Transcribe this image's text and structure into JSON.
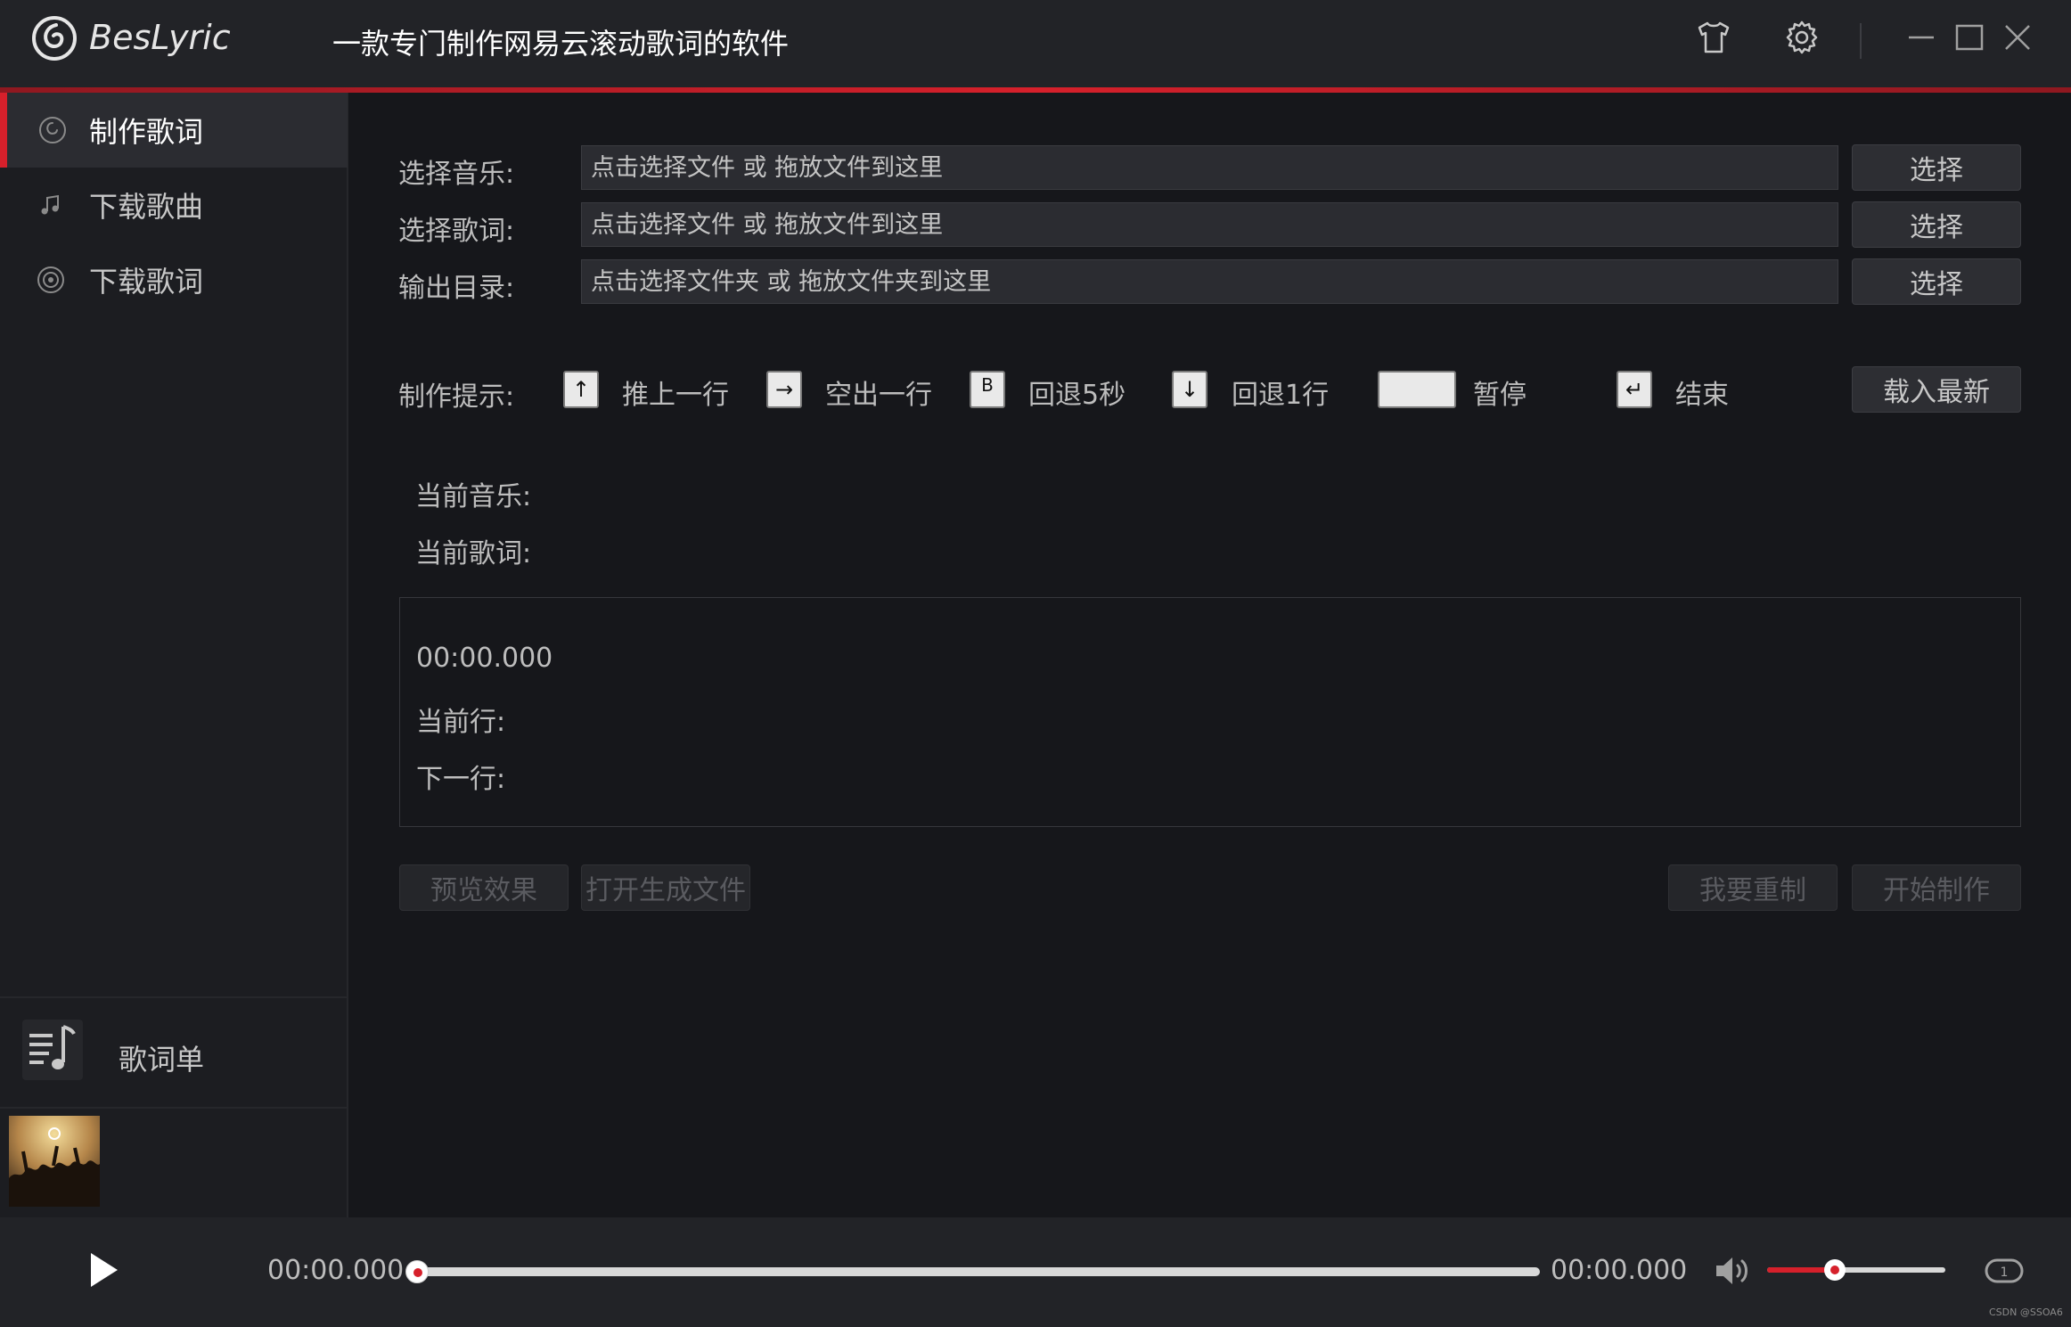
{
  "app": {
    "name": "BesLyric",
    "subtitle": "一款专门制作网易云滚动歌词的软件"
  },
  "sidebar": {
    "items": [
      {
        "label": "制作歌词",
        "icon": "make-lyric-icon"
      },
      {
        "label": "下载歌曲",
        "icon": "music-note-icon"
      },
      {
        "label": "下载歌词",
        "icon": "download-lyric-icon"
      }
    ],
    "playlist_label": "歌词单"
  },
  "form": {
    "music_label": "选择音乐:",
    "lyric_label": "选择歌词:",
    "output_label": "输出目录:",
    "music_placeholder": "点击选择文件 或 拖放文件到这里",
    "lyric_placeholder": "点击选择文件 或 拖放文件到这里",
    "output_placeholder": "点击选择文件夹 或 拖放文件夹到这里",
    "choose_label": "选择"
  },
  "hints": {
    "label": "制作提示:",
    "up_key": "↑",
    "up_text": "推上一行",
    "right_key": "→",
    "right_text": "空出一行",
    "b_key": "B",
    "b_text": "回退5秒",
    "down_key": "↓",
    "down_text": "回退1行",
    "space_text": "暂停",
    "enter_key": "↵",
    "enter_text": "结束",
    "load_latest": "载入最新"
  },
  "current": {
    "music_label": "当前音乐:",
    "lyric_label": "当前歌词:"
  },
  "panel": {
    "time": "00:00.000",
    "current_line_label": "当前行:",
    "next_line_label": "下一行:"
  },
  "actions": {
    "preview": "预览效果",
    "open_file": "打开生成文件",
    "redo": "我要重制",
    "start": "开始制作"
  },
  "player": {
    "current_time": "00:00.000",
    "total_time": "00:00.000",
    "progress": 0,
    "volume": 0.38,
    "loop_badge": "1"
  },
  "watermark": "CSDN @SSOA6",
  "colors": {
    "accent": "#d6202b",
    "background": "#16171b",
    "sidebar": "#1c1d21",
    "titlebar": "#222327"
  }
}
